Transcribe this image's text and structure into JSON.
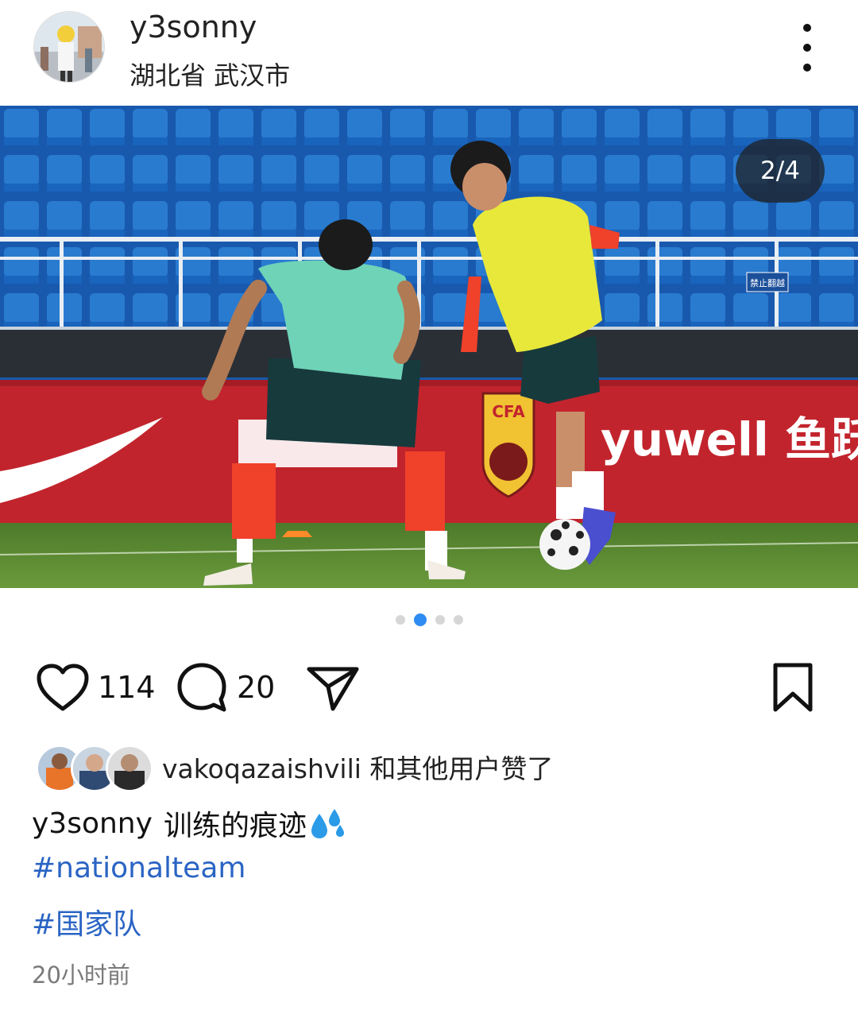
{
  "post": {
    "username": "y3sonny",
    "location": "湖北省 武汉市",
    "image_counter": "2/4",
    "carousel": {
      "total": 4,
      "current": 2
    },
    "likes_count": "114",
    "comments_count": "20",
    "liked_by_text": "vakoqazaishvili 和其他用户赞了",
    "caption_user": "y3sonny",
    "caption_text": "训练的痕迹",
    "caption_emoji": "sweat-droplets-icon",
    "hashtags": [
      "#nationalteam",
      "#国家队"
    ],
    "timestamp": "20小时前"
  },
  "photo_text": {
    "sponsor_right": "yuwell 鱼跃",
    "crest": "CFA",
    "sign": "禁止翻越"
  },
  "icons": {
    "more": "more-vertical-icon",
    "like": "heart-outline-icon",
    "comment": "comment-bubble-icon",
    "share": "paper-plane-icon",
    "save": "bookmark-outline-icon"
  },
  "colors": {
    "accent": "#2f8cf0",
    "hashtag": "#2a64c4",
    "muted": "#7a7a7a"
  }
}
